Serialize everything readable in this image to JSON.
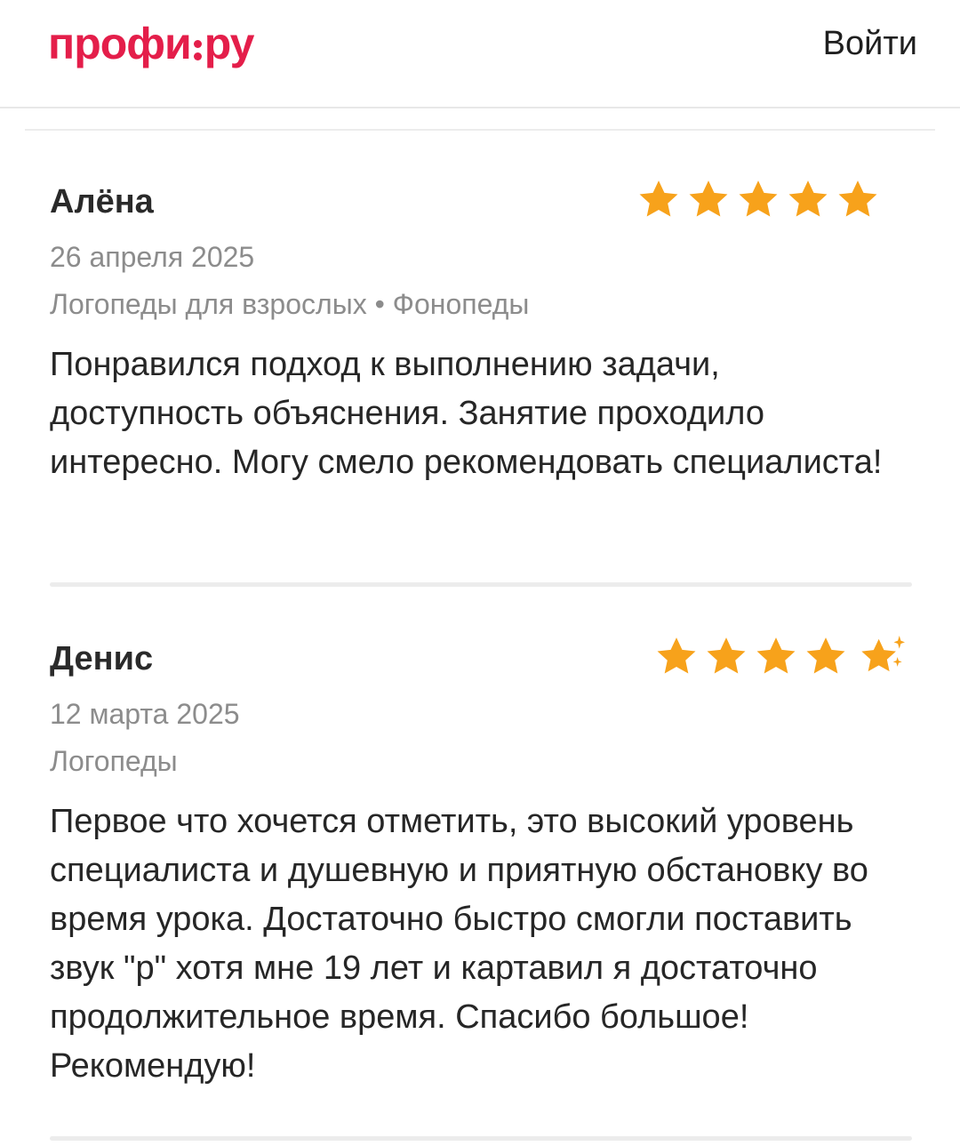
{
  "header": {
    "logo_left": "профи",
    "logo_right": "ру",
    "login_label": "Войти"
  },
  "reviews": [
    {
      "name": "Алёна",
      "date": "26 апреля 2025",
      "categories": "Логопеды для взрослых • Фонопеды",
      "rating": 5,
      "text": "Понравился подход к выполнению задачи, доступность объяснения. Занятие проходило интересно. Могу смело рекомендовать специалиста!"
    },
    {
      "name": "Денис",
      "date": "12 марта 2025",
      "categories": "Логопеды",
      "rating": 5,
      "rating_badge": "sparkle-icon",
      "text": "Первое что хочется отметить, это высокий уровень специалиста и душевную и приятную обстановку во время урока. Достаточно быстро смогли поставить звук \"р\" хотя мне 19 лет и картавил я достаточно продолжительное время. Спасибо большое! Рекомендую!"
    }
  ],
  "colors": {
    "brand": "#e41e4a",
    "star": "#f7a21b",
    "muted_text": "#8c8c8c",
    "divider": "#ececec"
  }
}
